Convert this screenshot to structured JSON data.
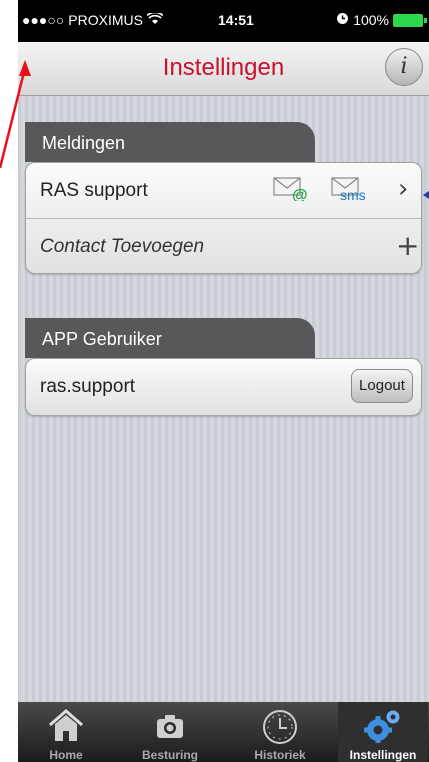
{
  "status_bar": {
    "signal": "●●●○○",
    "carrier": "PROXIMUS",
    "wifi_icon": "wifi-icon",
    "time": "14:51",
    "alarm_icon": "alarm-icon",
    "battery": "100%"
  },
  "nav": {
    "title": "Instellingen",
    "info_label": "i"
  },
  "sections": {
    "meldingen": {
      "title": "Meldingen",
      "items": [
        {
          "label": "RAS support",
          "email_badge": "@",
          "sms_badge": "sms",
          "chevron": "›"
        },
        {
          "label": "Contact Toevoegen",
          "action": "+"
        }
      ]
    },
    "gebruiker": {
      "title": "APP Gebruiker",
      "user": "ras.support",
      "logout_label": "Logout"
    }
  },
  "tabbar": {
    "tabs": [
      {
        "label": "Home",
        "icon": "home-icon"
      },
      {
        "label": "Besturing",
        "icon": "camera-icon"
      },
      {
        "label": "Historiek",
        "icon": "clock-icon"
      },
      {
        "label": "Instellingen",
        "icon": "gears-icon"
      }
    ],
    "active_index": 3
  },
  "colors": {
    "title_red": "#c8102e",
    "annotation_red": "#e8101a",
    "battery_green": "#2ed84c",
    "section_tab": "#58585a"
  }
}
